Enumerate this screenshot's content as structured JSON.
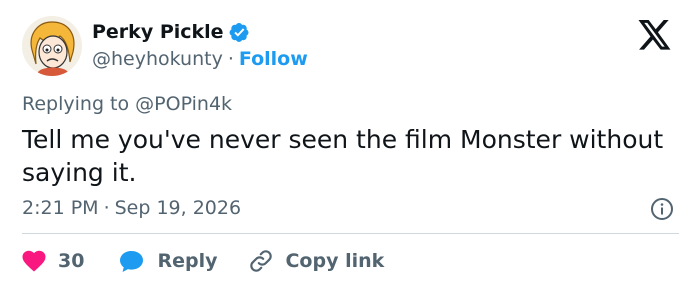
{
  "author": {
    "display_name": "Perky Pickle",
    "handle": "@heyhokunty",
    "separator": "·",
    "follow_label": "Follow"
  },
  "reply_context": {
    "prefix": "Replying to",
    "mention": "@POPin4k"
  },
  "tweet": {
    "text": "Tell me you've never seen the film Monster without saying it.",
    "time": "2:21 PM",
    "separator": "·",
    "date": "Sep 19, 2026"
  },
  "actions": {
    "like_count": "30",
    "reply_label": "Reply",
    "copy_label": "Copy link"
  },
  "icons": {
    "verified": "verified-badge-icon",
    "x": "x-logo-icon",
    "info": "info-icon",
    "like": "heart-icon",
    "reply": "speech-bubble-icon",
    "copy": "link-icon"
  },
  "colors": {
    "accent": "#1d9bf0",
    "like": "#f91880",
    "text": "#0f1419",
    "muted": "#536471",
    "divider": "#cfd9de"
  }
}
